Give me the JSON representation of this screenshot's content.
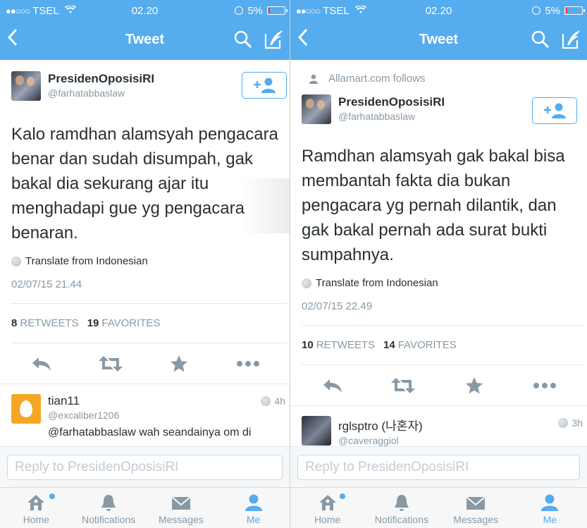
{
  "screens": [
    {
      "status": {
        "dots": "●●○○○",
        "carrier": "TSEL",
        "time": "02.20",
        "battery": "5%"
      },
      "nav": {
        "back": "<",
        "title": "Tweet"
      },
      "follows_label": "",
      "author": {
        "name": "PresidenOposisiRI",
        "handle": "@farhatabbaslaw"
      },
      "text": "Kalo ramdhan alamsyah pengacara benar dan sudah disumpah, gak bakal dia sekurang ajar itu menghadapi gue yg pengacara benaran.",
      "translate": "Translate from Indonesian",
      "date": "02/07/15 21.44",
      "retweets_count": "8",
      "retweets_label": "RETWEETS",
      "favorites_count": "19",
      "favorites_label": "FAVORITES",
      "reply": {
        "name": "tian11",
        "handle": "@excaliber1206",
        "time": "4h",
        "text": "@farhatabbaslaw wah seandainya om di"
      },
      "reply_placeholder": "Reply to PresidenOposisiRI"
    },
    {
      "status": {
        "dots": "●●○○○",
        "carrier": "TSEL",
        "time": "02.20",
        "battery": "5%"
      },
      "nav": {
        "back": "<",
        "title": "Tweet"
      },
      "follows_label": "Allamart.com follows",
      "author": {
        "name": "PresidenOposisiRI",
        "handle": "@farhatabbaslaw"
      },
      "text": "Ramdhan alamsyah gak bakal bisa membantah fakta dia bukan pengacara yg pernah dilantik, dan gak bakal pernah ada surat bukti sumpahnya.",
      "translate": "Translate from Indonesian",
      "date": "02/07/15 22.49",
      "retweets_count": "10",
      "retweets_label": "RETWEETS",
      "favorites_count": "14",
      "favorites_label": "FAVORITES",
      "reply": {
        "name": "rglsptro (나혼자)",
        "handle": "@caveraggiol",
        "time": "3h",
        "text": ""
      },
      "reply_placeholder": "Reply to PresidenOposisiRI"
    }
  ],
  "tabs": [
    {
      "label": "Home",
      "icon": "home-icon"
    },
    {
      "label": "Notifications",
      "icon": "bell-icon"
    },
    {
      "label": "Messages",
      "icon": "envelope-icon"
    },
    {
      "label": "Me",
      "icon": "person-icon"
    }
  ],
  "colors": {
    "brand": "#55acee",
    "text": "#292f33",
    "muted": "#8899a6"
  }
}
